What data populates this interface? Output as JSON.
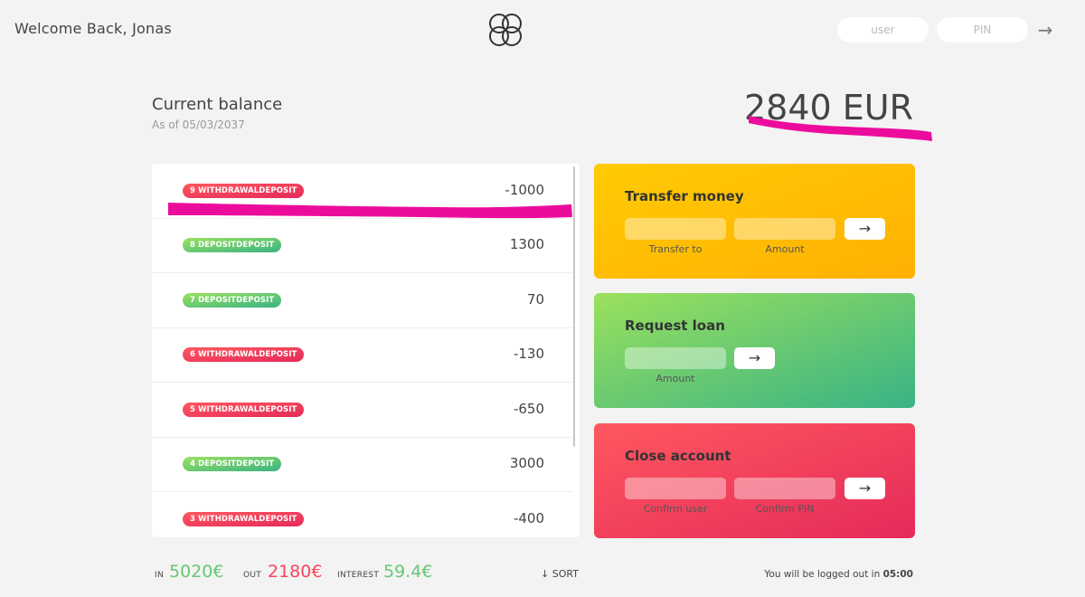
{
  "nav": {
    "welcome": "Welcome Back, Jonas",
    "user_placeholder": "user",
    "pin_placeholder": "PIN",
    "login_arrow": "→"
  },
  "balance": {
    "label": "Current balance",
    "date": "As of 05/03/2037",
    "value": "2840 EUR"
  },
  "movements": [
    {
      "type": "9 withdrawaldeposit",
      "kind": "withdrawal",
      "value": "-1000"
    },
    {
      "type": "8 depositdeposit",
      "kind": "deposit",
      "value": "1300"
    },
    {
      "type": "7 depositdeposit",
      "kind": "deposit",
      "value": "70"
    },
    {
      "type": "6 withdrawaldeposit",
      "kind": "withdrawal",
      "value": "-130"
    },
    {
      "type": "5 withdrawaldeposit",
      "kind": "withdrawal",
      "value": "-650"
    },
    {
      "type": "4 depositdeposit",
      "kind": "deposit",
      "value": "3000"
    },
    {
      "type": "3 withdrawaldeposit",
      "kind": "withdrawal",
      "value": "-400"
    }
  ],
  "operations": {
    "transfer": {
      "title": "Transfer money",
      "label_to": "Transfer to",
      "label_amount": "Amount",
      "btn": "→"
    },
    "loan": {
      "title": "Request loan",
      "label_amount": "Amount",
      "btn": "→"
    },
    "close": {
      "title": "Close account",
      "label_user": "Confirm user",
      "label_pin": "Confirm PIN",
      "btn": "→"
    }
  },
  "summary": {
    "in_label": "In",
    "in_value": "5020€",
    "out_label": "Out",
    "out_value": "2180€",
    "interest_label": "Interest",
    "interest_value": "59.4€",
    "sort": "↓ SORT",
    "logout_text": "You will be logged out in ",
    "timer": "05:00"
  },
  "colors": {
    "highlight": "#ec0c9c",
    "deposit": "#66c873",
    "withdrawal": "#f5465d"
  }
}
